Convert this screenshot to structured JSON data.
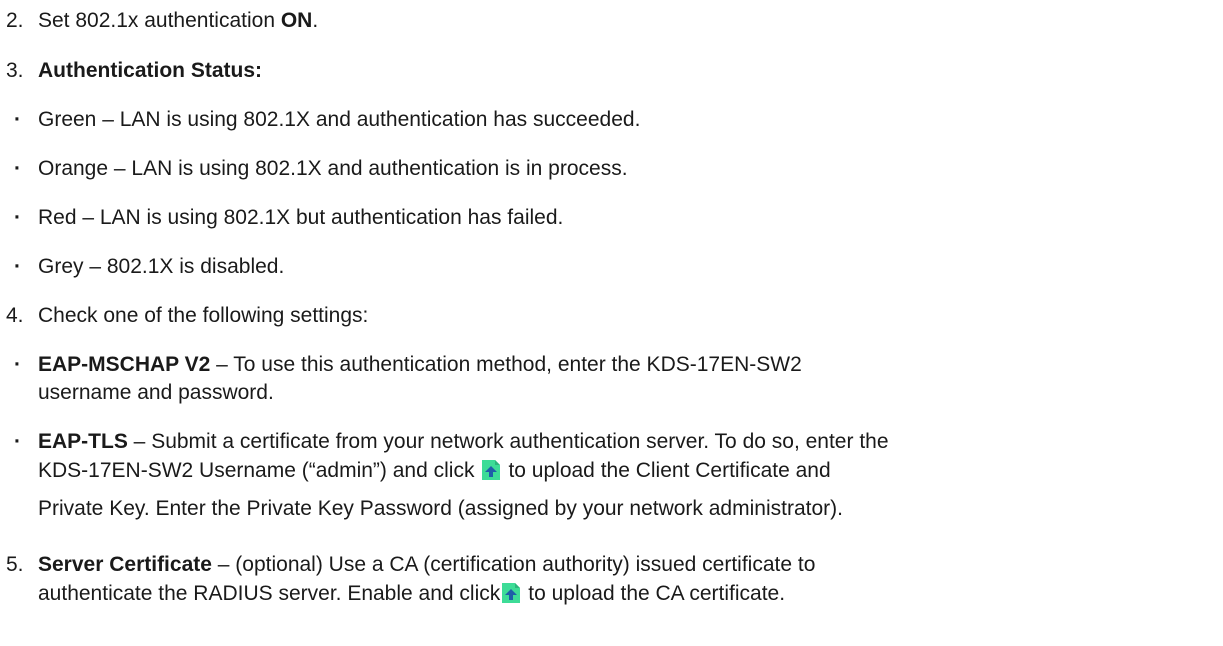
{
  "items": {
    "step2": {
      "num": "2.",
      "text_a": "Set 802.1x authentication ",
      "bold": "ON",
      "text_b": "."
    },
    "step3": {
      "num": "3.",
      "bold": "Authentication Status:"
    },
    "status_bullets": [
      {
        "bullet": "·",
        "text": "Green – LAN is using 802.1X and authentication has succeeded."
      },
      {
        "bullet": "·",
        "text": "Orange – LAN is using 802.1X and authentication is in process."
      },
      {
        "bullet": "·",
        "text": "Red – LAN is using 802.1X but authentication has failed."
      },
      {
        "bullet": "·",
        "text": "Grey – 802.1X is disabled."
      }
    ],
    "step4": {
      "num": "4.",
      "text": "Check one of the following settings:"
    },
    "eap_mschap": {
      "bullet": "·",
      "bold": "EAP-MSCHAP V2",
      "text_a": " – To use this authentication method, enter the KDS-17EN-SW2",
      "text_b": "username and password."
    },
    "eap_tls": {
      "bullet": "·",
      "bold": "EAP-TLS",
      "text_a": " – Submit a certificate from your network authentication server. To do so, enter the",
      "text_b1": "KDS-17EN-SW2 Username (“admin”) and click",
      "text_b2": "to upload the Client Certificate and",
      "text_c": "Private Key. Enter the Private Key Password (assigned by your network administrator)."
    },
    "step5": {
      "num": "5.",
      "bold": "Server Certificate",
      "text_a": " – (optional) Use a CA (certification authority) issued certificate to",
      "text_b1": "authenticate the RADIUS server. Enable and click",
      "text_b2": "to upload the CA certificate."
    }
  },
  "icons": {
    "upload": "upload-icon",
    "color_bg": "#3ddc97",
    "color_arrow": "#1f5fa8"
  }
}
